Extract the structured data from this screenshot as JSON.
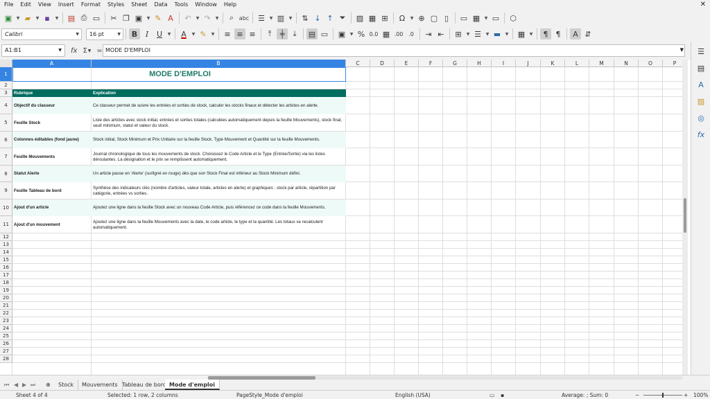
{
  "menu": [
    "File",
    "Edit",
    "View",
    "Insert",
    "Format",
    "Styles",
    "Sheet",
    "Data",
    "Tools",
    "Window",
    "Help"
  ],
  "toolbar1_icons": [
    "new-icon",
    "open-icon",
    "save-icon",
    "export-pdf-icon",
    "print-icon",
    "print-preview-icon",
    "cut-icon",
    "copy-icon",
    "paste-icon",
    "clone-formatting-icon",
    "clear-formatting-icon",
    "undo-icon",
    "redo-icon",
    "find-replace-icon",
    "spelling-icon",
    "row-icon",
    "column-icon",
    "sort-icon",
    "sort-ascending-icon",
    "sort-descending-icon",
    "autofilter-icon",
    "image-icon",
    "chart-icon",
    "pivot-table-icon",
    "special-character-icon",
    "hyperlink-icon",
    "comment-icon",
    "headers-footers-icon",
    "define-print-area-icon",
    "freeze-rows-columns-icon",
    "split-window-icon",
    "show-draw-functions-icon"
  ],
  "font": {
    "name": "Calibri",
    "size": "16 pt"
  },
  "name_box": "A1:B1",
  "formula": "MODE D'EMPLOI",
  "columns": [
    "A",
    "B",
    "C",
    "D",
    "E",
    "F",
    "G",
    "H",
    "I",
    "J",
    "K",
    "L",
    "M",
    "N",
    "O",
    "P"
  ],
  "rows": [
    "1",
    "2",
    "3",
    "4",
    "5",
    "6",
    "7",
    "8",
    "9",
    "10",
    "11",
    "12",
    "13",
    "14",
    "15",
    "16",
    "17",
    "18",
    "19",
    "20",
    "21",
    "22",
    "23",
    "24",
    "25",
    "26",
    "27",
    "28"
  ],
  "sheet": {
    "title": "MODE D'EMPLOI",
    "header": {
      "a": "Rubrique",
      "b": "Explication"
    },
    "entries": [
      {
        "a": "Objectif du classeur",
        "b": "Ce classeur permet de suivre les entrées et sorties de stock, calculer les stocks finaux et détecter les articles en alerte."
      },
      {
        "a": "Feuille Stock",
        "b": "Liste des articles avec stock initial, entrées et sorties totales (calculées automatiquement depuis la feuille Mouvements), stock final, seuil minimum, statut et valeur du stock."
      },
      {
        "a": "Colonnes éditables (fond jaune)",
        "b": "Stock initial, Stock Minimum et Prix Unitaire sur la feuille Stock. Type Mouvement et Quantité sur la feuille Mouvements."
      },
      {
        "a": "Feuille Mouvements",
        "b": "Journal chronologique de tous les mouvements de stock. Choisissez le Code Article et le Type (Entrée/Sortie) via les listes déroulantes. La désignation et le prix se remplissent automatiquement."
      },
      {
        "a": "Statut Alerte",
        "b": "Un article passe en 'Alerte' (surligné en rouge) dès que son Stock Final est inférieur au Stock Minimum défini."
      },
      {
        "a": "Feuille Tableau de bord",
        "b": "Synthèse des indicateurs clés (nombre d'articles, valeur totale, articles en alerte) et graphiques : stock par article, répartition par catégorie, entrées vs sorties."
      },
      {
        "a": "Ajout d'un article",
        "b": "Ajoutez une ligne dans la feuille Stock avec un nouveau Code Article, puis référencez ce code dans la feuille Mouvements."
      },
      {
        "a": "Ajout d'un mouvement",
        "b": "Ajoutez une ligne dans la feuille Mouvements avec la date, le code article, le type et la quantité. Les totaux se recalculent automatiquement."
      }
    ]
  },
  "tabs": [
    {
      "label": "Stock",
      "active": false
    },
    {
      "label": "Mouvements",
      "active": false
    },
    {
      "label": "Tableau de bord",
      "active": false
    },
    {
      "label": "Mode d'emploi",
      "active": true
    }
  ],
  "status": {
    "sheet": "Sheet 4 of 4",
    "selection": "Selected: 1 row, 2 columns",
    "page_style": "PageStyle_Mode d'emploi",
    "language": "English (USA)",
    "summary": "Average: ; Sum: 0",
    "zoom": "100%"
  },
  "colors": {
    "header_green": "#006d5f",
    "title_green": "#1e7a6b",
    "selection_blue": "#3584e4",
    "alt_row": "#eefaf8"
  }
}
